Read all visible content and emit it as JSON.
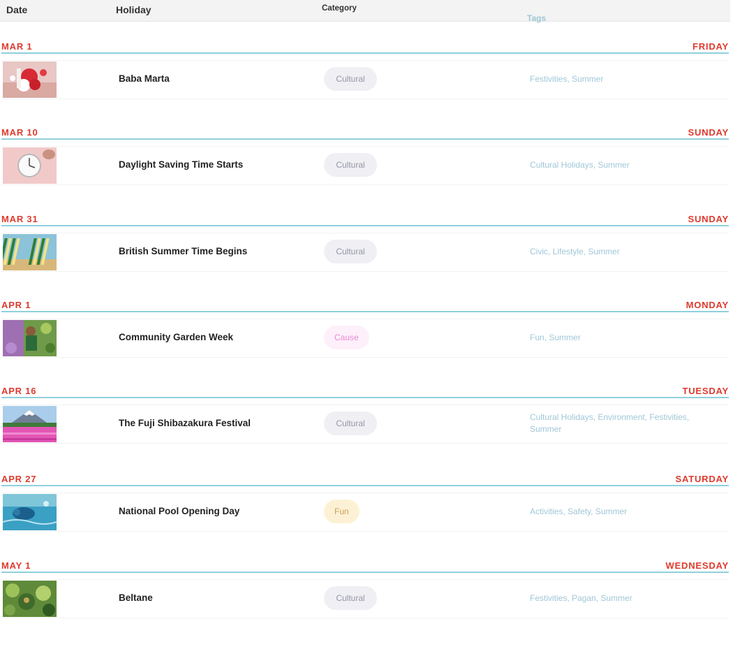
{
  "columns": {
    "date": "Date",
    "holiday": "Holiday",
    "category": "Category",
    "tags": "Tags"
  },
  "colors": {
    "date_red": "#de3a2d",
    "divider_blue": "#8fd0de",
    "tag_blue": "#9fc7d7",
    "cultural_badge": "#efeff4",
    "cause_badge": "#fdf0fa",
    "fun_badge": "#fdf1d5"
  },
  "entries": [
    {
      "date": "MAR 1",
      "day": "FRIDAY",
      "name": "Baba Marta",
      "category": "Cultural",
      "category_type": "cultural",
      "tags": "Festivities, Summer",
      "thumbnail": "red-white-martenitsa-photo"
    },
    {
      "date": "MAR 10",
      "day": "SUNDAY",
      "name": "Daylight Saving Time Starts",
      "category": "Cultural",
      "category_type": "cultural",
      "tags": "Cultural Holidays, Summer",
      "thumbnail": "clock-photo"
    },
    {
      "date": "MAR 31",
      "day": "SUNDAY",
      "name": "British Summer Time Begins",
      "category": "Cultural",
      "category_type": "cultural",
      "tags": "Civic, Lifestyle, Summer",
      "thumbnail": "striped-deckchairs-photo"
    },
    {
      "date": "APR 1",
      "day": "MONDAY",
      "name": "Community Garden Week",
      "category": "Cause",
      "category_type": "cause",
      "tags": "Fun, Summer",
      "thumbnail": "gardener-photo"
    },
    {
      "date": "APR 16",
      "day": "TUESDAY",
      "name": "The Fuji Shibazakura Festival",
      "category": "Cultural",
      "category_type": "cultural",
      "tags": "Cultural Holidays, Environment, Festivities, Summer",
      "thumbnail": "mount-fuji-pink-flowers-photo"
    },
    {
      "date": "APR 27",
      "day": "SATURDAY",
      "name": "National Pool Opening Day",
      "category": "Fun",
      "category_type": "fun",
      "tags": "Activities, Safety, Summer",
      "thumbnail": "pool-swimmer-photo"
    },
    {
      "date": "MAY 1",
      "day": "WEDNESDAY",
      "name": "Beltane",
      "category": "Cultural",
      "category_type": "cultural",
      "tags": "Festivities, Pagan, Summer",
      "thumbnail": "green-foliage-photo"
    }
  ]
}
